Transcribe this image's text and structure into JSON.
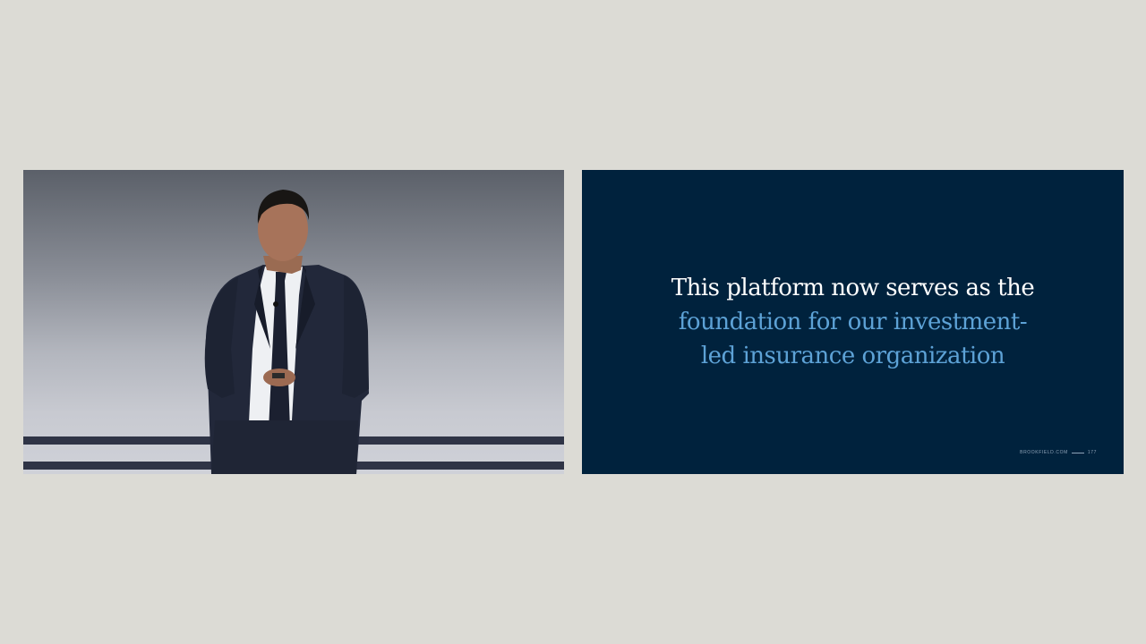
{
  "slide": {
    "line1": "This platform now serves as the",
    "line2": "foundation for our investment-",
    "line3": "led insurance organization",
    "footer_site": "BROOKFIELD.COM",
    "footer_page": "177"
  },
  "colors": {
    "background": "#dcdbd5",
    "slide_background": "#00223d",
    "slide_text_white": "#ffffff",
    "slide_text_accent": "#5da2d6",
    "stage_stripe": "#2f3446"
  }
}
